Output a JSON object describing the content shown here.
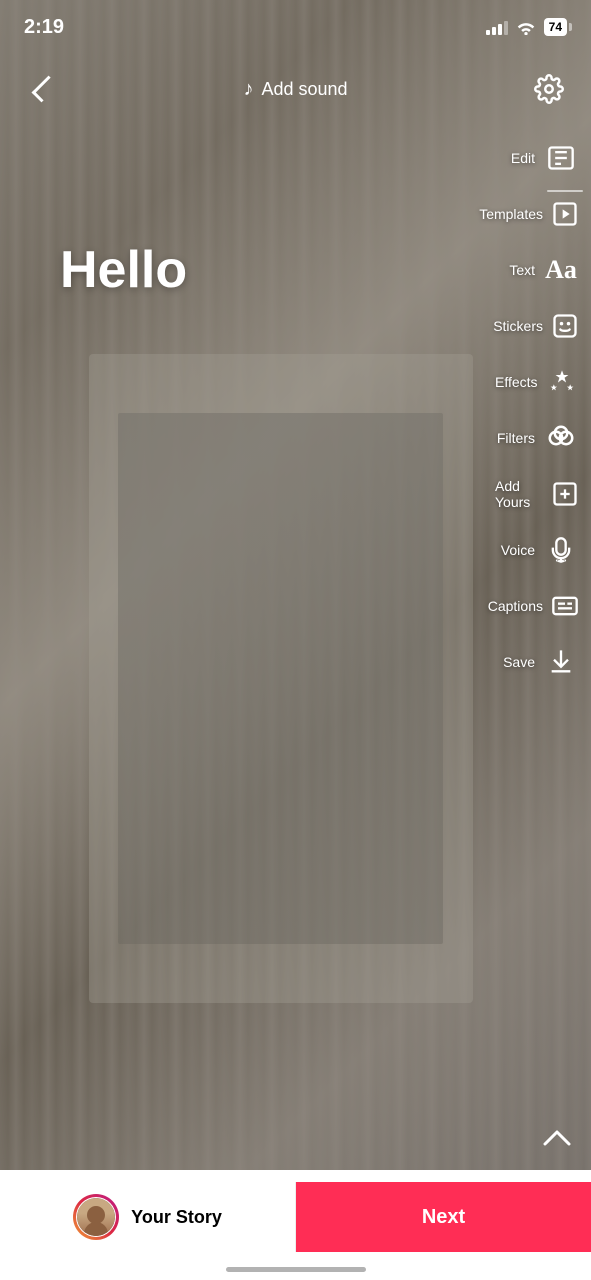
{
  "statusBar": {
    "time": "2:19",
    "battery": "74"
  },
  "topBar": {
    "addSound": "Add sound",
    "backIcon": "chevron-left",
    "settingsIcon": "gear"
  },
  "content": {
    "helloText": "Hello"
  },
  "toolbar": {
    "items": [
      {
        "label": "Edit",
        "icon": "edit-icon"
      },
      {
        "label": "Templates",
        "icon": "templates-icon"
      },
      {
        "label": "Text",
        "icon": "text-icon"
      },
      {
        "label": "Stickers",
        "icon": "stickers-icon"
      },
      {
        "label": "Effects",
        "icon": "effects-icon"
      },
      {
        "label": "Filters",
        "icon": "filters-icon"
      },
      {
        "label": "Add Yours",
        "icon": "add-yours-icon"
      },
      {
        "label": "Voice",
        "icon": "voice-icon"
      },
      {
        "label": "Captions",
        "icon": "captions-icon"
      },
      {
        "label": "Save",
        "icon": "save-icon"
      }
    ]
  },
  "bottomBar": {
    "yourStory": "Your Story",
    "next": "Next"
  }
}
